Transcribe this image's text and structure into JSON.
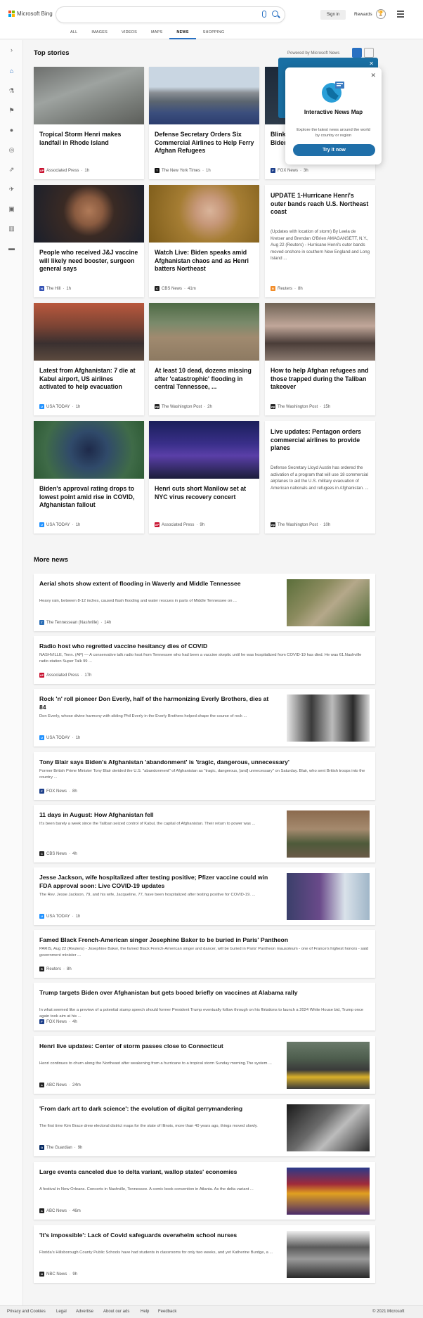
{
  "header": {
    "brand": "Microsoft Bing",
    "sign_in": "Sign in",
    "rewards": "Rewards",
    "tabs": [
      "ALL",
      "IMAGES",
      "VIDEOS",
      "MAPS",
      "NEWS",
      "SHOPPING"
    ]
  },
  "top_stories": {
    "title": "Top stories",
    "powered": "Powered by Microsoft News"
  },
  "popup": {
    "title": "Interactive News Map",
    "desc": "Explore the latest news around the world by country or region",
    "button": "Try it now"
  },
  "cards": [
    {
      "title": "Tropical Storm Henri makes landfall in Rhode Island",
      "source": "Associated Press",
      "time": "1h",
      "logo": "AP",
      "logo_color": "#c8102e",
      "img": "storm"
    },
    {
      "title": "Defense Secretary Orders Six Commercial Airlines to Help Ferry Afghan Refugees",
      "source": "The New York Times",
      "time": "1h",
      "logo": "T",
      "logo_color": "#111111",
      "img": "airport"
    },
    {
      "title": "Blinken says Afghan 'gone ' ... Biden",
      "source": "FOX News",
      "time": "3h",
      "logo": "F",
      "logo_color": "#1d3f8a",
      "img": "dark"
    },
    {
      "title": "People who received J&J vaccine will likely need booster, surgeon general says",
      "source": "The Hill",
      "time": "1h",
      "logo": "H",
      "logo_color": "#3452b4",
      "img": "surgeon"
    },
    {
      "title": "Watch Live: Biden speaks amid Afghanistan chaos and as Henri batters Northeast",
      "source": "CBS News",
      "time": "41m",
      "logo": "C",
      "logo_color": "#222222",
      "img": "biden"
    },
    {
      "title": "UPDATE 1-Hurricane Henri's outer bands reach U.S. Northeast coast",
      "desc": "(Updates with location of storm) By Leela de Kretser and Brendan O'Brien AMAGANSETT, N.Y., Aug 22 (Reuters) - Hurricane Henri's outer bands moved onshore in southern New England and Long Island ...",
      "source": "Reuters",
      "time": "8h",
      "logo": "R",
      "logo_color": "#f28c28",
      "img": ""
    },
    {
      "title": "Latest from Afghanistan: 7 die at Kabul airport, US airlines activated to help evacuation",
      "source": "USA TODAY",
      "time": "1h",
      "logo": "U",
      "logo_color": "#1e90ff",
      "img": "kabul"
    },
    {
      "title": "At least 10 dead, dozens missing after 'catastrophic' flooding in central Tennessee, ...",
      "source": "The Washington Post",
      "time": "2h",
      "logo": "wp",
      "logo_color": "#222222",
      "img": "flood"
    },
    {
      "title": "How to help Afghan refugees and those trapped during the Taliban takeover",
      "source": "The Washington Post",
      "time": "15h",
      "logo": "wp",
      "logo_color": "#222222",
      "img": "refugees"
    },
    {
      "title": "Biden's approval rating drops to lowest point amid rise in COVID, Afghanistan fallout",
      "source": "USA TODAY",
      "time": "1h",
      "logo": "U",
      "logo_color": "#1e90ff",
      "img": "biden2"
    },
    {
      "title": "Henri cuts short Manilow set at NYC virus recovery concert",
      "source": "Associated Press",
      "time": "9h",
      "logo": "AP",
      "logo_color": "#c8102e",
      "img": "concert"
    },
    {
      "title": "Live updates: Pentagon orders commercial airlines to provide planes",
      "desc": "Defense Secretary Lloyd Austin has ordered the activation of a program that will use 18 commercial airplanes to aid the U.S. military evacuation of American nationals and refugees in Afghanistan. ...",
      "source": "The Washington Post",
      "time": "10h",
      "logo": "wp",
      "logo_color": "#222222",
      "img": ""
    }
  ],
  "more_news": {
    "title": "More news",
    "items": [
      {
        "title": "Aerial shots show extent of flooding in Waverly and Middle Tennessee",
        "desc": "Heavy rain, between 8-12 inches, caused flash flooding and water rescues in parts of Middle Tennessee on ...",
        "source": "The Tennessean (Nashville)",
        "time": "14h",
        "logo": "T",
        "logo_color": "#2a6db5",
        "img": "aerial"
      },
      {
        "title": "Radio host who regretted vaccine hesitancy dies of COVID",
        "desc": "NASHVILLE, Tenn. (AP) — A conservative talk radio host from Tennessee who had been a vaccine skeptic until he was hospitalized from COVID-19 has died. He was 61.Nashville radio station Super Talk 99 ...",
        "source": "Associated Press",
        "time": "17h",
        "logo": "AP",
        "logo_color": "#c8102e",
        "img": ""
      },
      {
        "title": "Rock 'n' roll pioneer Don Everly, half of the harmonizing Everly Brothers, dies at 84",
        "desc": "Don Everly, whose divine harmony with sibling Phil Everly in the Everly Brothers helped shape the course of rock ...",
        "source": "USA TODAY",
        "time": "1h",
        "logo": "U",
        "logo_color": "#1e90ff",
        "img": "everly"
      },
      {
        "title": "Tony Blair says Biden's Afghanistan 'abandonment' is 'tragic, dangerous, unnecessary'",
        "desc": "Former British Prime Minister Tony Blair derided the U.S. \"abandonment\" of Afghanistan as \"tragic, dangerous, [and] unnecessary\" on Saturday.  Blair, who sent British troops into the country ...",
        "source": "FOX News",
        "time": "8h",
        "logo": "F",
        "logo_color": "#1d3f8a",
        "img": ""
      },
      {
        "title": "11 days in August: How Afghanistan fell",
        "desc": "It's been barely a week since the Taliban seized control of Kabul, the capital of Afghanistan. Their return to power was ...",
        "source": "CBS News",
        "time": "4h",
        "logo": "C",
        "logo_color": "#222222",
        "img": "taliban"
      },
      {
        "title": "Jesse Jackson, wife hospitalized after testing positive; Pfizer vaccine could win FDA approval soon: Live COVID-19 updates",
        "desc": "The Rev. Jesse Jackson, 79, and his wife, Jacqueline, 77, have been hospitalized after testing positive for COVID-19. ...",
        "source": "USA TODAY",
        "time": "1h",
        "logo": "U",
        "logo_color": "#1e90ff",
        "img": "vaccine"
      },
      {
        "title": "Famed Black French-American singer Josephine Baker to be buried in Paris' Pantheon",
        "desc": "PARIS, Aug 22 (Reuters) - Josephine Baker, the famed Black French-American singer and dancer, will be buried in Paris' Pantheon mausoleum - one of France's highest honors - said government minister ...",
        "source": "Reuters",
        "time": "8h",
        "logo": "R",
        "logo_color": "#222222",
        "img": ""
      },
      {
        "title": "Trump targets Biden over Afghanistan but gets booed briefly on vaccines at Alabama rally",
        "desc": "In what seemed like a preview of a potential stump speech should former President Trump eventually follow through on his flirtations to launch a 2024 White House bid, Trump once again took aim at his ...",
        "source": "FOX News",
        "time": "4h",
        "logo": "F",
        "logo_color": "#1d3f8a",
        "img": ""
      },
      {
        "title": "Henri live updates: Center of storm passes close to Connecticut",
        "desc": "Henri continues to churn along the Northeast after weakening from a hurricane to a tropical storm Sunday morning.The system ...",
        "source": "ABC News",
        "time": "24m",
        "logo": "a",
        "logo_color": "#222222",
        "img": "road"
      },
      {
        "title": "'From dark art to dark science': the evolution of digital gerrymandering",
        "desc": "The first time Kim Brace drew electoral district maps for the state of Illinois, more than 40 years ago, things moved slowly.",
        "source": "The Guardian",
        "time": "9h",
        "logo": "G",
        "logo_color": "#052962",
        "img": "gerry"
      },
      {
        "title": "Large events canceled due to delta variant, wallop states' economies",
        "desc": "A festival in New Orleans. Concerts in Nashville, Tennessee. A comic book convention in Atlanta. As the delta variant ...",
        "source": "ABC News",
        "time": "46m",
        "logo": "a",
        "logo_color": "#222222",
        "img": "festival"
      },
      {
        "title": "'It's impossible': Lack of Covid safeguards overwhelm school nurses",
        "desc": "Florida's Hillsborough County Public Schools have had students in classrooms for only two weeks, and yet Katherine Burdge, a ...",
        "source": "NBC News",
        "time": "9h",
        "logo": "N",
        "logo_color": "#222222",
        "img": "school"
      }
    ]
  },
  "footer": {
    "links": [
      "Privacy and Cookies",
      "Legal",
      "Advertise",
      "About our ads",
      "Help",
      "Feedback"
    ],
    "copyright": "© 2021 Microsoft"
  }
}
